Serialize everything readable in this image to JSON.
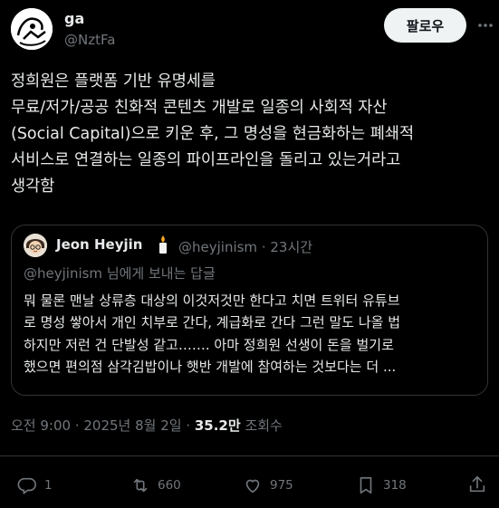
{
  "author": {
    "name": "ga",
    "handle": "@NztFa",
    "avatar_icon": "cartoon-avatar"
  },
  "follow_label": "팔로우",
  "tweet_text": "정희원은 플랫폼 기반 유명세를\n무료/저가/공공 친화적 콘텐츠 개발로 일종의 사회적 자산\n(Social Capital)으로 키운 후, 그 명성을 현금화하는 폐쇄적\n서비스로 연결하는 일종의 파이프라인을 돌리고 있는거라고\n생각함",
  "quote": {
    "name": "Jeon Heyjin",
    "name_emoji": "candle",
    "handle_time": "@heyjinism · 23시간",
    "reply_to": "@heyjinism 님에게 보내는 답글",
    "body": "뭐 물론 맨날 상류층 대상의 이것저것만 한다고 치면 트위터 유튜브\n로 명성 쌓아서 개인 치부로 간다, 계급화로 간다 그런 말도 나올 법\n하지만 저런 건 단발성 같고……. 아마 정희원 선생이 돈을 벌기로\n했으면 편의점 삼각김밥이나 햇반 개발에 참여하는 것보다는 더 ..."
  },
  "meta": {
    "time_date": "오전 9:00 · 2025년 8월 2일 · ",
    "views": "35.2만",
    "views_label": " 조회수"
  },
  "actions": {
    "replies": "1",
    "retweets": "660",
    "likes": "975",
    "bookmarks": "318"
  },
  "colors": {
    "background": "#000000",
    "text": "#e7e9ea",
    "secondary": "#71767b",
    "border": "#2f3336"
  }
}
